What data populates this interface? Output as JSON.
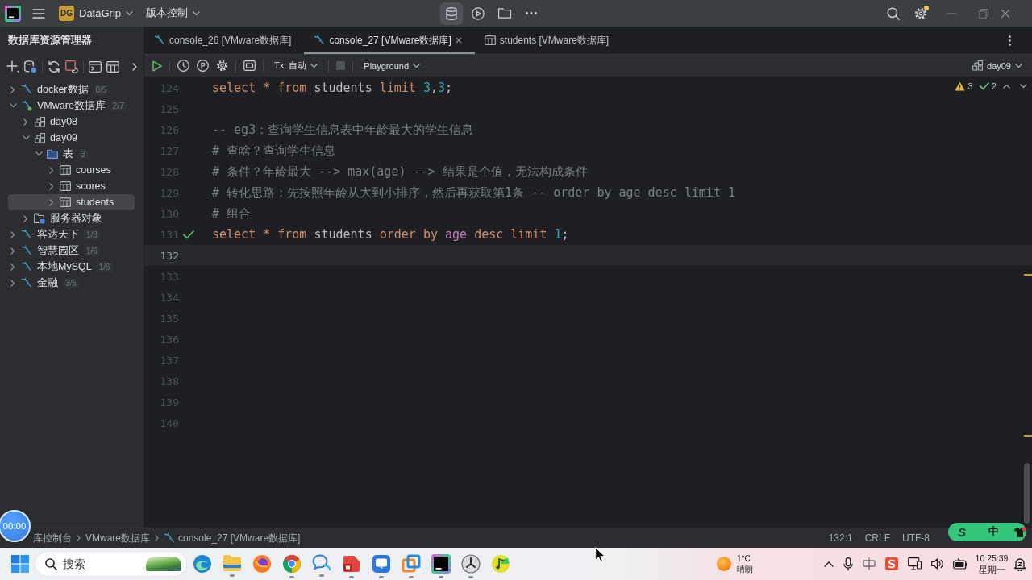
{
  "title_bar": {
    "project_initials": "DG",
    "project": "DataGrip",
    "vcs_menu": "版本控制",
    "tools": [
      {
        "kind": "database",
        "selected": true
      },
      {
        "kind": "run",
        "selected": false
      },
      {
        "kind": "folder",
        "selected": false
      },
      {
        "kind": "more",
        "selected": false
      }
    ],
    "settings_badge": true
  },
  "sidebar": {
    "title": "数据库资源管理器",
    "tree": [
      {
        "label": "docker数据",
        "kind": "datasource",
        "count": "0/5",
        "expanded": false,
        "selected": false,
        "connected": false
      },
      {
        "label": "VMware数据库",
        "kind": "datasource",
        "count": "2/7",
        "expanded": true,
        "selected": false,
        "connected": true,
        "children": [
          {
            "label": "day08",
            "kind": "schema",
            "expanded": false,
            "selected": false
          },
          {
            "label": "day09",
            "kind": "schema",
            "expanded": true,
            "selected": false,
            "children": [
              {
                "label": "表",
                "kind": "folder",
                "count": "3",
                "expanded": true,
                "selected": false,
                "children": [
                  {
                    "label": "courses",
                    "kind": "table",
                    "expanded": false,
                    "selected": false
                  },
                  {
                    "label": "scores",
                    "kind": "table",
                    "expanded": false,
                    "selected": false
                  },
                  {
                    "label": "students",
                    "kind": "table",
                    "expanded": false,
                    "selected": true
                  }
                ]
              }
            ]
          },
          {
            "label": "服务器对象",
            "kind": "server-folder",
            "expanded": false,
            "selected": false
          }
        ]
      },
      {
        "label": "客达天下",
        "kind": "datasource",
        "count": "1/3",
        "expanded": false,
        "selected": false,
        "connected": false
      },
      {
        "label": "智慧园区",
        "kind": "datasource",
        "count": "1/6",
        "expanded": false,
        "selected": false,
        "connected": false
      },
      {
        "label": "本地MySQL",
        "kind": "datasource",
        "count": "1/6",
        "expanded": false,
        "selected": false,
        "connected": false
      },
      {
        "label": "金融",
        "kind": "datasource",
        "count": "3/5",
        "expanded": false,
        "selected": false,
        "connected": false
      }
    ]
  },
  "tabs": [
    {
      "label": "console_26 [VMware数据库]",
      "kind": "console",
      "selected": false
    },
    {
      "label": "console_27 [VMware数据库]",
      "kind": "console",
      "selected": true
    },
    {
      "label": "students [VMware数据库]",
      "kind": "table",
      "selected": false
    }
  ],
  "editor_toolbar": {
    "transaction_mode": "Tx: 自动",
    "stop_enabled": false,
    "session": "Playground",
    "schema": "day09"
  },
  "inspections": {
    "warnings": "3",
    "passed": "2"
  },
  "editor": {
    "lines": [
      {
        "number": "124",
        "executed": false,
        "current": false,
        "tokens": [
          {
            "kind": "keyword",
            "text": "select"
          },
          {
            "kind": "operator",
            "text": "*"
          },
          {
            "kind": "keyword",
            "text": "from"
          },
          {
            "kind": "table",
            "text": "students"
          },
          {
            "kind": "keyword",
            "text": "limit"
          },
          {
            "kind": "number",
            "text": "3"
          },
          {
            "kind": "punct",
            "text": ","
          },
          {
            "kind": "number",
            "text": "3"
          },
          {
            "kind": "punct",
            "text": ";"
          }
        ]
      },
      {
        "number": "125",
        "executed": false,
        "current": false
      },
      {
        "number": "126",
        "executed": false,
        "current": false,
        "tokens": [
          {
            "kind": "comment",
            "text": "-- eg3：查询学生信息表中年龄最大的学生信息"
          }
        ]
      },
      {
        "number": "127",
        "executed": false,
        "current": false,
        "tokens": [
          {
            "kind": "comment",
            "text": "# 查啥？查询学生信息"
          }
        ]
      },
      {
        "number": "128",
        "executed": false,
        "current": false,
        "tokens": [
          {
            "kind": "comment",
            "text": "# 条件？年龄最大 --> max(age) --> 结果是个值，无法构成条件"
          }
        ]
      },
      {
        "number": "129",
        "executed": false,
        "current": false,
        "tokens": [
          {
            "kind": "comment",
            "text": "# 转化思路：先按照年龄从大到小排序，然后再获取第1条 -- order by age desc limit 1"
          }
        ]
      },
      {
        "number": "130",
        "executed": false,
        "current": false,
        "tokens": [
          {
            "kind": "comment",
            "text": "# 组合"
          }
        ]
      },
      {
        "number": "131",
        "executed": true,
        "current": false,
        "tokens": [
          {
            "kind": "keyword",
            "text": "select"
          },
          {
            "kind": "operator",
            "text": "*"
          },
          {
            "kind": "keyword",
            "text": "from"
          },
          {
            "kind": "table",
            "text": "students"
          },
          {
            "kind": "keyword",
            "text": "order"
          },
          {
            "kind": "keyword",
            "text": "by"
          },
          {
            "kind": "column",
            "text": "age"
          },
          {
            "kind": "keyword",
            "text": "desc"
          },
          {
            "kind": "keyword",
            "text": "limit"
          },
          {
            "kind": "number",
            "text": "1"
          },
          {
            "kind": "punct",
            "text": ";"
          }
        ]
      },
      {
        "number": "132",
        "executed": false,
        "current": true
      },
      {
        "number": "133",
        "executed": false,
        "current": false
      },
      {
        "number": "134",
        "executed": false,
        "current": false
      },
      {
        "number": "135",
        "executed": false,
        "current": false
      },
      {
        "number": "136",
        "executed": false,
        "current": false
      },
      {
        "number": "137",
        "executed": false,
        "current": false
      },
      {
        "number": "138",
        "executed": false,
        "current": false
      },
      {
        "number": "139",
        "executed": false,
        "current": false
      },
      {
        "number": "140",
        "executed": false,
        "current": false
      }
    ]
  },
  "status_bar": {
    "breadcrumbs": [
      {
        "label": "库控制台",
        "kind": "plain"
      },
      {
        "label": "VMware数据库",
        "kind": "plain"
      },
      {
        "label": "console_27 [VMware数据库]",
        "kind": "console"
      }
    ],
    "caret_position": "132:1",
    "line_separator": "CRLF",
    "encoding": "UTF-8"
  },
  "recorder_timer": "00:00",
  "ime_toolbar": {
    "logo": "S",
    "mode": "中"
  },
  "taskbar": {
    "search": {
      "placeholder": "搜索"
    },
    "apps": [
      {
        "kind": "swirl",
        "running": false
      },
      {
        "kind": "folder",
        "running": true
      },
      {
        "kind": "globe",
        "running": false
      },
      {
        "kind": "ring",
        "running": true
      },
      {
        "kind": "bubbles",
        "running": true
      },
      {
        "kind": "slides",
        "running": true
      },
      {
        "kind": "message",
        "running": true
      },
      {
        "kind": "squares",
        "running": true
      },
      {
        "kind": "ide",
        "running": true
      },
      {
        "kind": "clock",
        "running": true
      },
      {
        "kind": "note",
        "running": false
      }
    ],
    "weather": {
      "temperature": "1°C",
      "condition": "晴朗"
    },
    "clock": {
      "time": "10:25:39",
      "day": "星期一"
    }
  }
}
